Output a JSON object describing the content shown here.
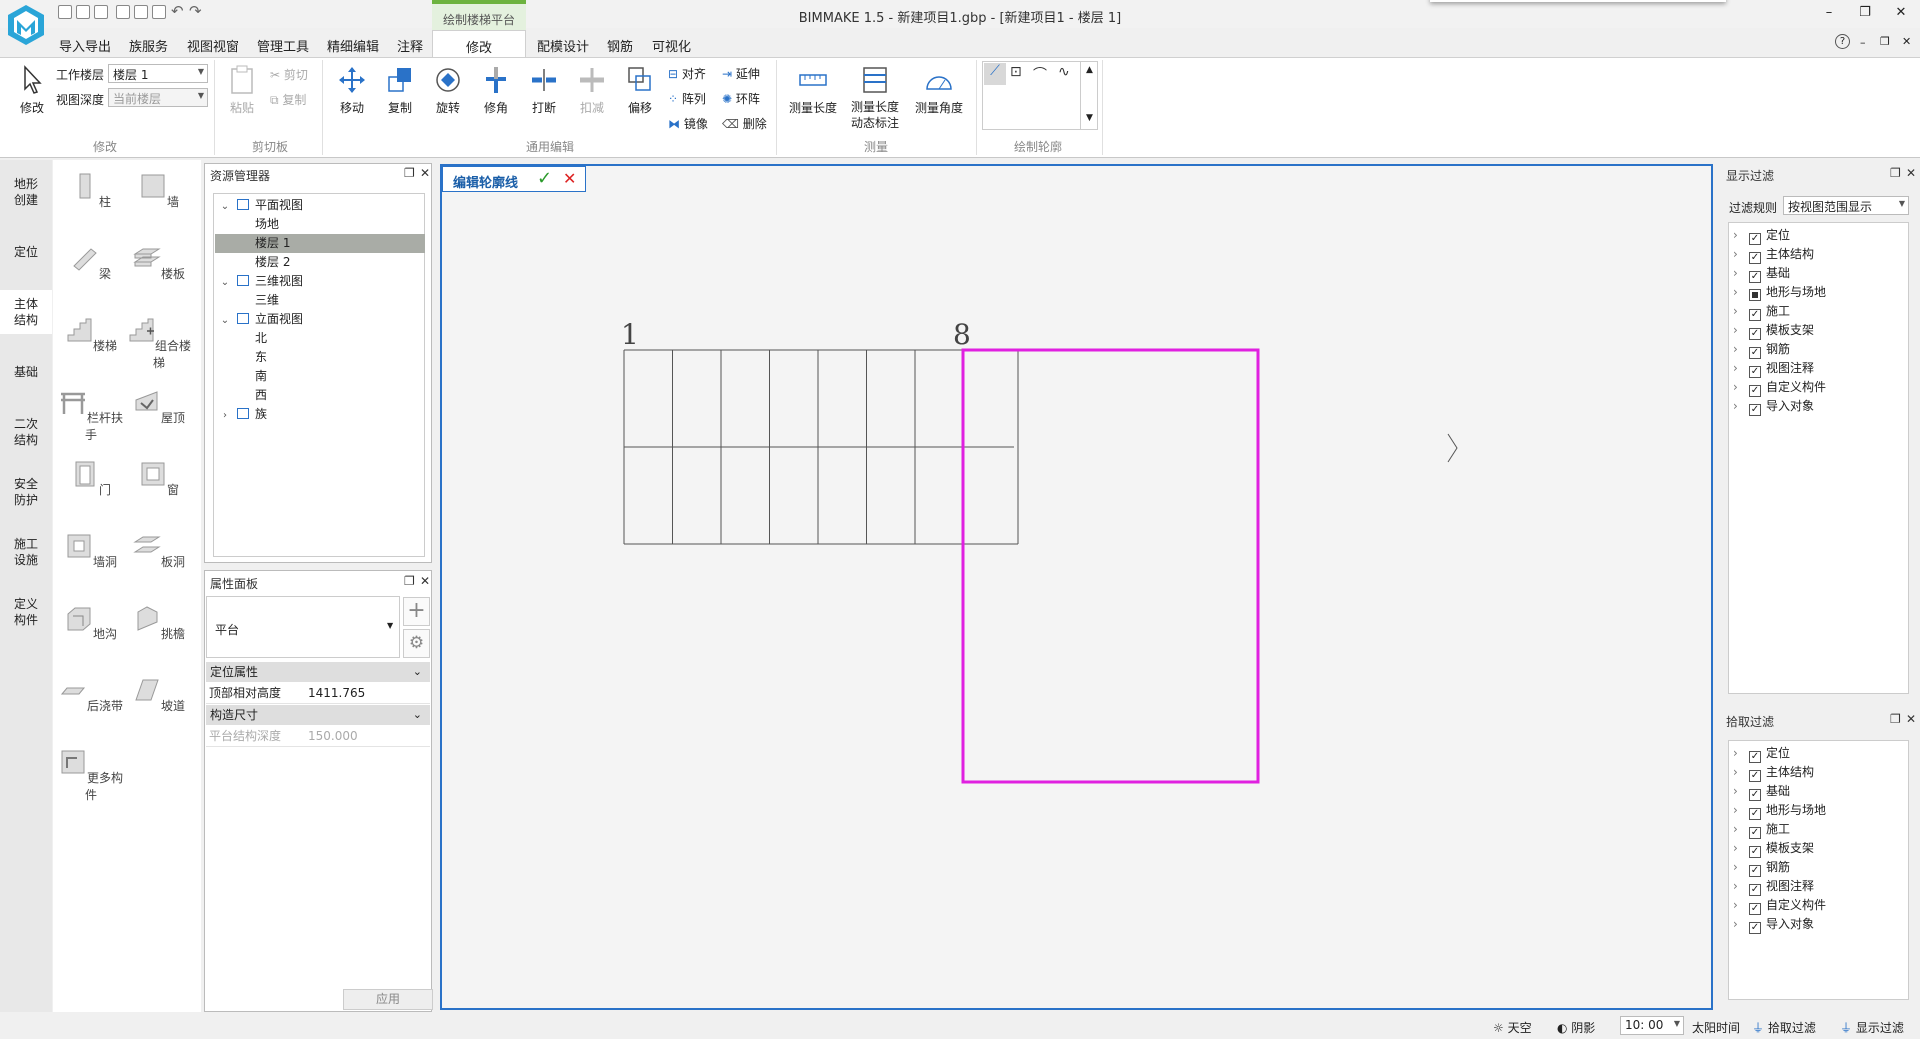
{
  "window": {
    "title": "BIMMAKE 1.5 - 新建项目1.gbp - [新建项目1 - 楼层 1]",
    "controls": {
      "minimize": "–",
      "restore": "❐",
      "close": "✕"
    }
  },
  "menubar": {
    "items": [
      "导入导出",
      "族服务",
      "视图视窗",
      "管理工具",
      "精细编辑",
      "注释"
    ],
    "context_header": "绘制楼梯平台",
    "context_tab": "修改",
    "items_after": [
      "配模设计",
      "钢筋",
      "可视化"
    ],
    "help": "?"
  },
  "ribbon": {
    "modify_group": {
      "modify_label": "修改",
      "work_floor_label": "工作楼层",
      "work_floor_value": "楼层 1",
      "view_depth_label": "视图深度",
      "view_depth_value": "当前楼层",
      "group_label": "修改"
    },
    "clipboard": {
      "paste": "粘贴",
      "cut": "剪切",
      "copy": "复制",
      "group_label": "剪切板"
    },
    "edit": {
      "move": "移动",
      "duplicate": "复制",
      "rotate": "旋转",
      "trim": "修角",
      "split": "打断",
      "deduct": "扣减",
      "offset": "偏移",
      "align": "对齐",
      "array": "阵列",
      "mirror": "镜像",
      "extend": "延伸",
      "ring_array": "环阵",
      "delete": "删除",
      "group_label": "通用编辑"
    },
    "measure": {
      "length": "测量长度",
      "dynamic_1": "测量长度",
      "dynamic_2": "动态标注",
      "angle": "测量角度",
      "group_label": "测量"
    },
    "draw": {
      "group_label": "绘制轮廓"
    }
  },
  "categories": [
    {
      "label": "地形\n创建",
      "active": false
    },
    {
      "label": "定位",
      "active": false
    },
    {
      "label": "主体\n结构",
      "active": true
    },
    {
      "label": "基础",
      "active": false
    },
    {
      "label": "二次\n结构",
      "active": false
    },
    {
      "label": "安全\n防护",
      "active": false
    },
    {
      "label": "施工\n设施",
      "active": false
    },
    {
      "label": "定义\n构件",
      "active": false
    }
  ],
  "palette": [
    "柱",
    "墙",
    "梁",
    "楼板",
    "楼梯",
    "组合楼梯",
    "栏杆扶手",
    "屋顶",
    "门",
    "窗",
    "墙洞",
    "板洞",
    "地沟",
    "挑檐",
    "后浇带",
    "坡道",
    "更多构件"
  ],
  "resource_panel": {
    "title": "资源管理器",
    "tree": [
      {
        "label": "平面视图",
        "level": 0,
        "expand": "v"
      },
      {
        "label": "场地",
        "level": 1
      },
      {
        "label": "楼层 1",
        "level": 1,
        "selected": true
      },
      {
        "label": "楼层 2",
        "level": 1
      },
      {
        "label": "三维视图",
        "level": 0,
        "expand": "v"
      },
      {
        "label": "三维",
        "level": 1
      },
      {
        "label": "立面视图",
        "level": 0,
        "expand": "v"
      },
      {
        "label": "北",
        "level": 1
      },
      {
        "label": "东",
        "level": 1
      },
      {
        "label": "南",
        "level": 1
      },
      {
        "label": "西",
        "level": 1
      },
      {
        "label": "族",
        "level": 0,
        "expand": ">"
      }
    ]
  },
  "property_panel": {
    "title": "属性面板",
    "type_value": "平台",
    "sections": [
      {
        "name": "定位属性",
        "rows": [
          {
            "key": "顶部相对高度",
            "value": "1411.765",
            "dim": false
          }
        ]
      },
      {
        "name": "构造尺寸",
        "rows": [
          {
            "key": "平台结构深度",
            "value": "150.000",
            "dim": true
          }
        ]
      }
    ],
    "apply_button": "应用"
  },
  "canvas": {
    "edit_tab_label": "编辑轮廓线",
    "stair_start_label": "1",
    "stair_end_label": "8",
    "platform_color": "#e020e0",
    "accent_color": "#2a72c8"
  },
  "display_filter": {
    "title": "显示过滤",
    "rule_label": "过滤规则",
    "rule_value": "按视图范围显示",
    "items": [
      {
        "label": "定位",
        "state": "checked"
      },
      {
        "label": "主体结构",
        "state": "checked"
      },
      {
        "label": "基础",
        "state": "checked"
      },
      {
        "label": "地形与场地",
        "state": "partial"
      },
      {
        "label": "施工",
        "state": "checked"
      },
      {
        "label": "模板支架",
        "state": "checked"
      },
      {
        "label": "钢筋",
        "state": "checked"
      },
      {
        "label": "视图注释",
        "state": "checked"
      },
      {
        "label": "自定义构件",
        "state": "checked"
      },
      {
        "label": "导入对象",
        "state": "checked"
      }
    ]
  },
  "pick_filter": {
    "title": "拾取过滤",
    "items": [
      "定位",
      "主体结构",
      "基础",
      "地形与场地",
      "施工",
      "模板支架",
      "钢筋",
      "视图注释",
      "自定义构件",
      "导入对象"
    ]
  },
  "statusbar": {
    "sky": "天空",
    "shadow": "阴影",
    "time_value": "10: 00",
    "sun_time": "太阳时间",
    "pick_filter": "拾取过滤",
    "display_filter": "显示过滤"
  }
}
